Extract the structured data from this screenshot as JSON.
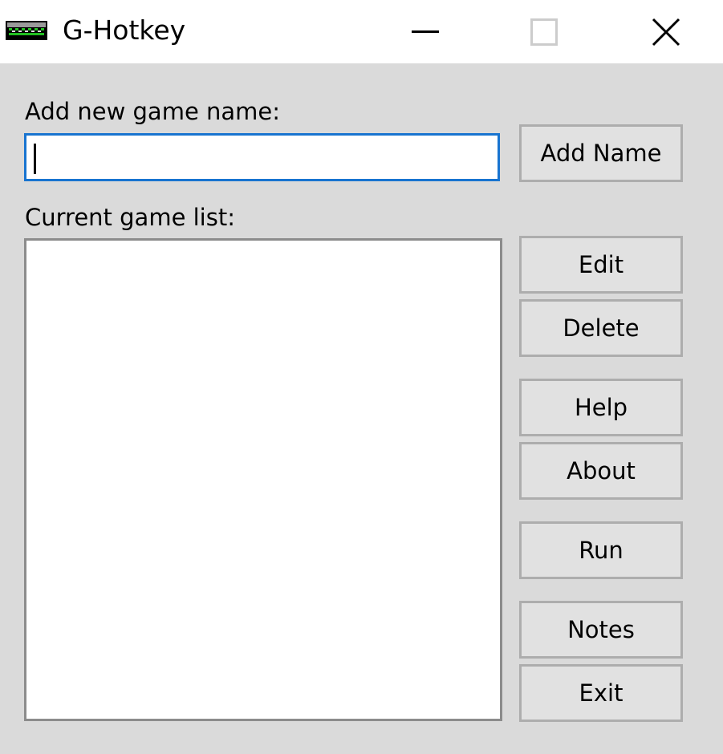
{
  "window": {
    "title": "G-Hotkey",
    "icon": "keyboard-icon",
    "controls": {
      "minimize": "minimize-icon",
      "maximize": "maximize-icon",
      "maximize_enabled": false,
      "close": "close-icon"
    }
  },
  "form": {
    "add_label": "Add new game name:",
    "name_input_value": "",
    "add_button": "Add Name",
    "list_label": "Current game list:",
    "game_list": []
  },
  "buttons": {
    "edit": "Edit",
    "delete": "Delete",
    "help": "Help",
    "about": "About",
    "run": "Run",
    "notes": "Notes",
    "exit": "Exit"
  },
  "colors": {
    "focus_border": "#1874d0",
    "background": "#dadada",
    "button_face": "#e1e1e1"
  }
}
